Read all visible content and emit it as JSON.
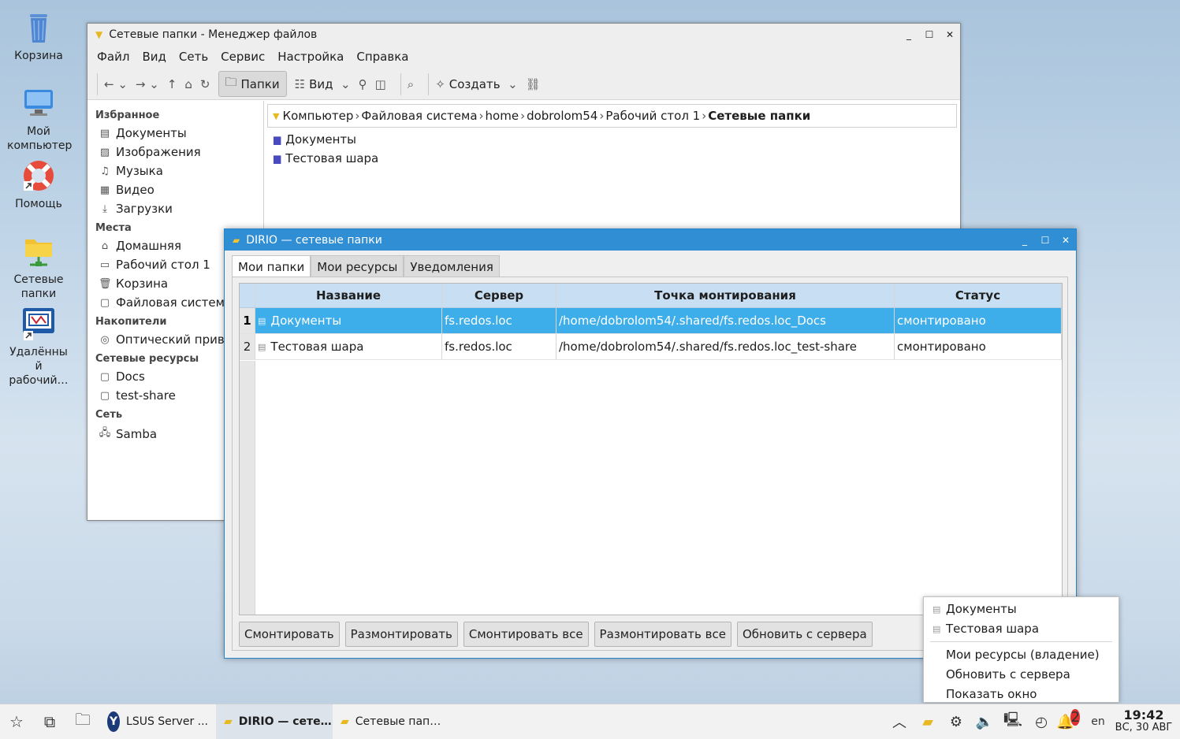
{
  "desktop": {
    "icons": [
      {
        "label": "Корзина"
      },
      {
        "label": "Мой компьютер"
      },
      {
        "label": "Помощь"
      },
      {
        "label": "Сетевые папки"
      },
      {
        "label": "Удалённы й рабочий…"
      }
    ]
  },
  "file_manager": {
    "title": "Сетевые папки - Менеджер файлов",
    "menu": [
      "Файл",
      "Вид",
      "Сеть",
      "Сервис",
      "Настройка",
      "Справка"
    ],
    "toolbar": {
      "folders_label": "Папки",
      "view_label": "Вид",
      "create_label": "Создать"
    },
    "sidebar": {
      "favorites_header": "Избранное",
      "favorites": [
        "Документы",
        "Изображения",
        "Музыка",
        "Видео",
        "Загрузки"
      ],
      "places_header": "Места",
      "places": [
        "Домашняя",
        "Рабочий стол 1",
        "Корзина",
        "Файловая систем"
      ],
      "drives_header": "Накопители",
      "drives": [
        "Оптический прив"
      ],
      "netres_header": "Сетевые ресурсы",
      "netres": [
        "Docs",
        "test-share"
      ],
      "network_header": "Сеть",
      "network": [
        "Samba"
      ]
    },
    "breadcrumb": [
      "Компьютер",
      "Файловая система",
      "home",
      "dobrolom54",
      "Рабочий стол 1",
      "Сетевые папки"
    ],
    "items": [
      "Документы",
      "Тестовая шара"
    ]
  },
  "dirio": {
    "title": "DIRIO — сетевые папки",
    "tabs": [
      "Мои папки",
      "Мои ресурсы",
      "Уведомления"
    ],
    "columns": [
      "Название",
      "Сервер",
      "Точка монтирования",
      "Статус"
    ],
    "rows": [
      {
        "num": "1",
        "name": "Документы",
        "server": "fs.redos.loc",
        "mount": "/home/dobrolom54/.shared/fs.redos.loc_Docs",
        "status": "смонтировано"
      },
      {
        "num": "2",
        "name": "Тестовая шара",
        "server": "fs.redos.loc",
        "mount": "/home/dobrolom54/.shared/fs.redos.loc_test-share",
        "status": "смонтировано"
      }
    ],
    "buttons": [
      "Смонтировать",
      "Размонтировать",
      "Смонтировать все",
      "Размонтировать все",
      "Обновить с сервера"
    ]
  },
  "context_menu": {
    "items_top": [
      "Документы",
      "Тестовая шара"
    ],
    "items_bottom": [
      "Мои ресурсы (владение)",
      "Обновить с сервера",
      "Показать окно"
    ]
  },
  "taskbar": {
    "tasks": [
      "LSUS Server ...",
      "DIRIO — сете…",
      "Сетевые пап…"
    ],
    "lang": "en",
    "notif_count": "2",
    "time": "19:42",
    "date": "ВС, 30 АВГ"
  },
  "colors": {
    "accent": "#3daee9",
    "title_active": "#2f8ed4",
    "header_bg": "#c8dff3"
  }
}
